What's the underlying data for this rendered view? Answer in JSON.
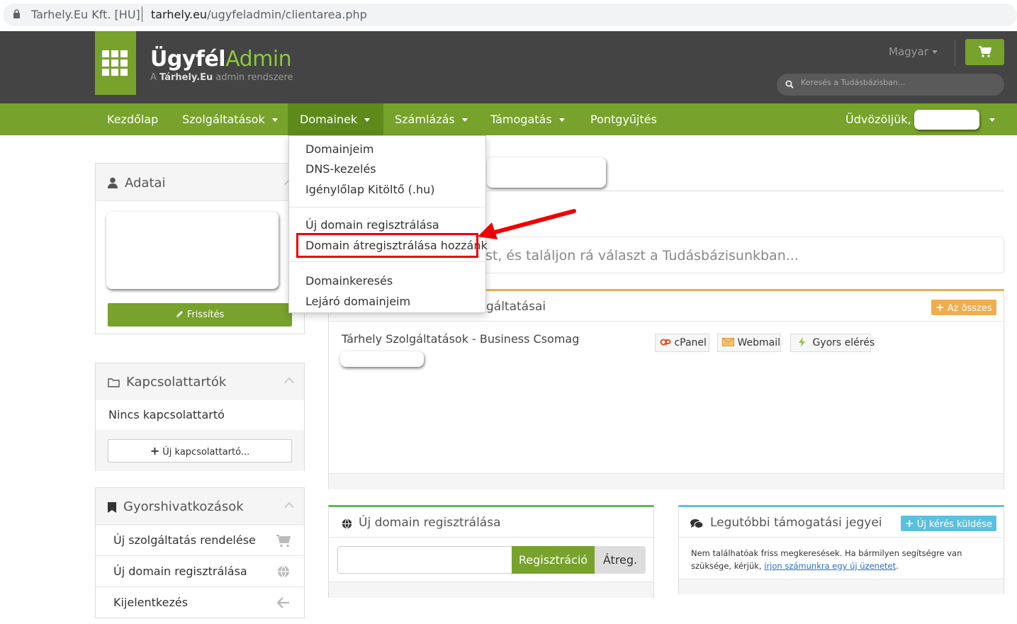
{
  "browser": {
    "site_name": "Tarhely.Eu Kft. [HU]",
    "url_domain": "tarhely.eu",
    "url_path": "/ugyfeladmin/clientarea.php"
  },
  "header": {
    "logo_part1": "Ügyfél",
    "logo_part2": "Admin",
    "logo_sub_prefix": "A ",
    "logo_sub_brand": "Tárhely.Eu",
    "logo_sub_suffix": " admin rendszere",
    "language": "Magyar",
    "search_placeholder": "Keresés a Tudásbázisban..."
  },
  "nav": {
    "items": [
      "Kezdőlap",
      "Szolgáltatások",
      "Domainek",
      "Számlázás",
      "Támogatás",
      "Pontgyűjtés"
    ],
    "welcome": "Üdvözöljük,"
  },
  "dropdown": {
    "group1": [
      "Domainjeim",
      "DNS-kezelés",
      "Igénylőlap Kitöltő (.hu)"
    ],
    "group2": [
      "Új domain regisztrálása",
      "Domain átregisztrálása hozzánk"
    ],
    "group3": [
      "Domainkeresés",
      "Lejáró domainjeim"
    ]
  },
  "sidebar": {
    "adatai_title": "Adatai",
    "refresh_label": "Frissítés",
    "contacts_title": "Kapcsolattartók",
    "no_contacts": "Nincs kapcsolattartó",
    "new_contact_label": "Új kapcsolattartó...",
    "shortcuts_title": "Gyorshivatkozások",
    "shortcuts": [
      "Új szolgáltatás rendelése",
      "Új domain regisztrálása",
      "Kijelentkezés"
    ]
  },
  "main": {
    "kb_search_text": "st, és találjon rá választ a Tudásbázisunkban...",
    "services_title_suffix": "gáltatásai",
    "view_all_label": "Az összes",
    "service_name": "Tárhely Szolgáltatások - Business Csomag",
    "service_buttons": [
      "cPanel",
      "Webmail",
      "Gyors elérés"
    ],
    "domain_panel_title": "Új domain regisztrálása",
    "register_label": "Regisztráció",
    "transfer_label": "Átreg.",
    "tickets_title": "Legutóbbi támogatási jegyei",
    "new_ticket_label": "Új kérés küldése",
    "tickets_text_1": "Nem találhatóak friss megkeresések. Ha bármilyen segítségre van",
    "tickets_text_2": "szüksége, kérjük, ",
    "tickets_link": "írjon számunkra egy új üzenetet",
    "tickets_text_3": "."
  },
  "colors": {
    "brand_green": "#77a22b",
    "header_dark": "#444444",
    "highlight_red": "#ee0000",
    "orange": "#f0ad4e",
    "cyan": "#5bc0de"
  }
}
